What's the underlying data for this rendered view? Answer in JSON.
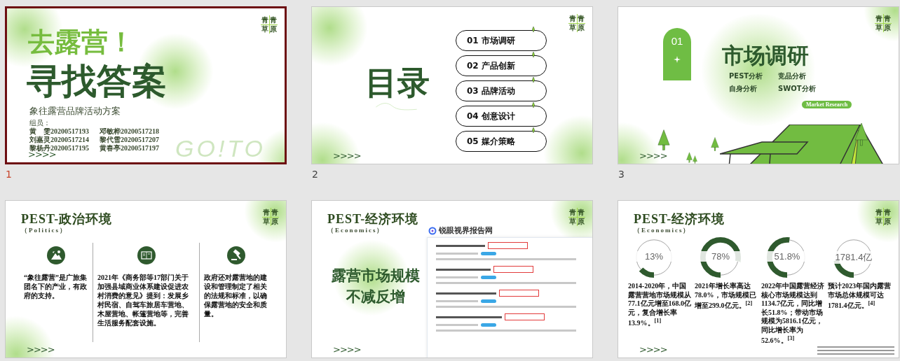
{
  "slides": [
    {
      "kind": "title",
      "number": "1",
      "selected": true,
      "logo": [
        "青",
        "青",
        "草",
        "原"
      ],
      "headline": "去露营！",
      "title": "寻找答案",
      "subtitle": "象往露营品牌活动方案",
      "members_label": "组员：",
      "members": [
        "黄　雯20200517193",
        "邓敏桦20200517218",
        "刘嘉灵20200517214",
        "黎代雪20200517207",
        "黎杨丹20200517195",
        "黄春亭20200517197"
      ],
      "watermark": "GO!TO",
      "arrows": ">>>>"
    },
    {
      "kind": "contents",
      "number": "2",
      "selected": false,
      "logo": [
        "青",
        "青",
        "草",
        "原"
      ],
      "title": "目录",
      "items": [
        "01 市场调研",
        "02 产品创新",
        "03 品牌活动",
        "04 创意设计",
        "05 媒介策略"
      ],
      "arrows": ">>>>"
    },
    {
      "kind": "section",
      "number": "3",
      "selected": false,
      "logo": [
        "青",
        "青",
        "草",
        "原"
      ],
      "badge": "01",
      "title": "市场调研",
      "topics": [
        "PEST分析",
        "竞品分析",
        "自身分析",
        "SWOT分析"
      ],
      "tag": "Market Research",
      "arrows": ">>>>"
    },
    {
      "kind": "columns",
      "selected": false,
      "logo": [
        "青",
        "青",
        "草",
        "原"
      ],
      "title": "PEST-政治环境",
      "subtitle": "（Politics）",
      "columns": [
        {
          "text": "“象往露营”是广旅集团名下的产业，有政府的支持。"
        },
        {
          "text": "2021年《商务部等17部门关于加强县域商业体系建设促进农村消费的意见》提到：发展乡村民宿、自驾车旅居车营地、木屋营地、帐篷营地等，完善生活服务配套设施。"
        },
        {
          "text": "政府还对露营地的建设和管理制定了相关的法规和标准，以确保露营地的安全和质量。"
        }
      ],
      "arrows": ">>>>"
    },
    {
      "kind": "report",
      "selected": false,
      "logo": [
        "青",
        "青",
        "草",
        "原"
      ],
      "title": "PEST-经济环境",
      "subtitle": "（Economics）",
      "headline": [
        "露营市场规模",
        "不减反增"
      ],
      "source": "锐眼视界报告网",
      "arrows": ">>>>"
    },
    {
      "kind": "stats",
      "selected": false,
      "logo": [
        "青",
        "青",
        "草",
        "原"
      ],
      "title": "PEST-经济环境",
      "subtitle": "（Economics）",
      "stats": [
        {
          "value": "13%",
          "level": 0.13,
          "text": "2014-2020年，中国露营营地市场规模从77.1亿元增至168.0亿元，复合增长率13.9%。$^{[1]}$"
        },
        {
          "value": "78%",
          "level": 0.78,
          "text": "2021年增长率高达78.0%，市场规模已增至299.0亿元。$^{[2]}$"
        },
        {
          "value": "51.8%",
          "level": 0.518,
          "text": "2022年中国露营经济核心市场规模达到1134.7亿元，同比增长51.8%；带动市场规模为5816.1亿元，同比增长率为52.6%。$^{[3]}$"
        },
        {
          "value": "1781.4亿",
          "level": 0.22,
          "text": "预计2023年国内露营市场总体规模可达1781.4亿元。$^{[4]}$"
        }
      ],
      "arrows": ">>>>"
    }
  ]
}
